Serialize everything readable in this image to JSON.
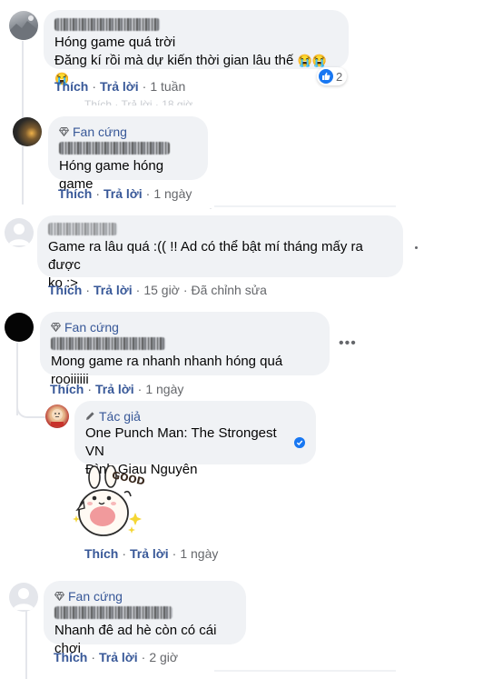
{
  "comments": [
    {
      "id": "c1",
      "lines": [
        "Hóng game quá trời",
        "Đăng kí rồi mà dự kiến thời gian lâu thế"
      ],
      "emojis": "😭😭😭",
      "reaction_count": "2",
      "actions": {
        "like": "Thích",
        "reply": "Trả lời",
        "time": "1 tuần"
      }
    },
    {
      "id": "c2",
      "badge": "Fan cứng",
      "lines": [
        "Hóng game hóng game"
      ],
      "actions": {
        "like": "Thích",
        "reply": "Trả lời",
        "time": "1 ngày"
      }
    },
    {
      "id": "c3",
      "lines": [
        "Game ra lâu quá :(( !! Ad có thể bật mí tháng mấy ra được",
        "ko :>"
      ],
      "actions": {
        "like": "Thích",
        "reply": "Trả lời",
        "time": "15 giờ",
        "edited": "Đã chỉnh sửa"
      }
    },
    {
      "id": "c4",
      "badge": "Fan cứng",
      "lines": [
        "Mong game ra nhanh nhanh hóng quá rooiiiiii"
      ],
      "actions": {
        "like": "Thích",
        "reply": "Trả lời",
        "time": "1 ngày"
      }
    },
    {
      "id": "c5",
      "badge": "Tác giả",
      "author_page": "One Punch Man: The Strongest VN",
      "author_person": "Đình Giau Nguyên",
      "sticker_text": "GOOD",
      "actions": {
        "like": "Thích",
        "reply": "Trả lời",
        "time": "1 ngày"
      }
    },
    {
      "id": "c6",
      "badge": "Fan cứng",
      "lines": [
        "Nhanh đê ad hè còn có cái chơi"
      ],
      "actions": {
        "like": "Thích",
        "reply": "Trả lời",
        "time": "2 giờ"
      }
    }
  ],
  "colors": {
    "bubble": "#f0f2f5",
    "link": "#385898",
    "meta": "#65676b",
    "verified": "#1877f2"
  }
}
